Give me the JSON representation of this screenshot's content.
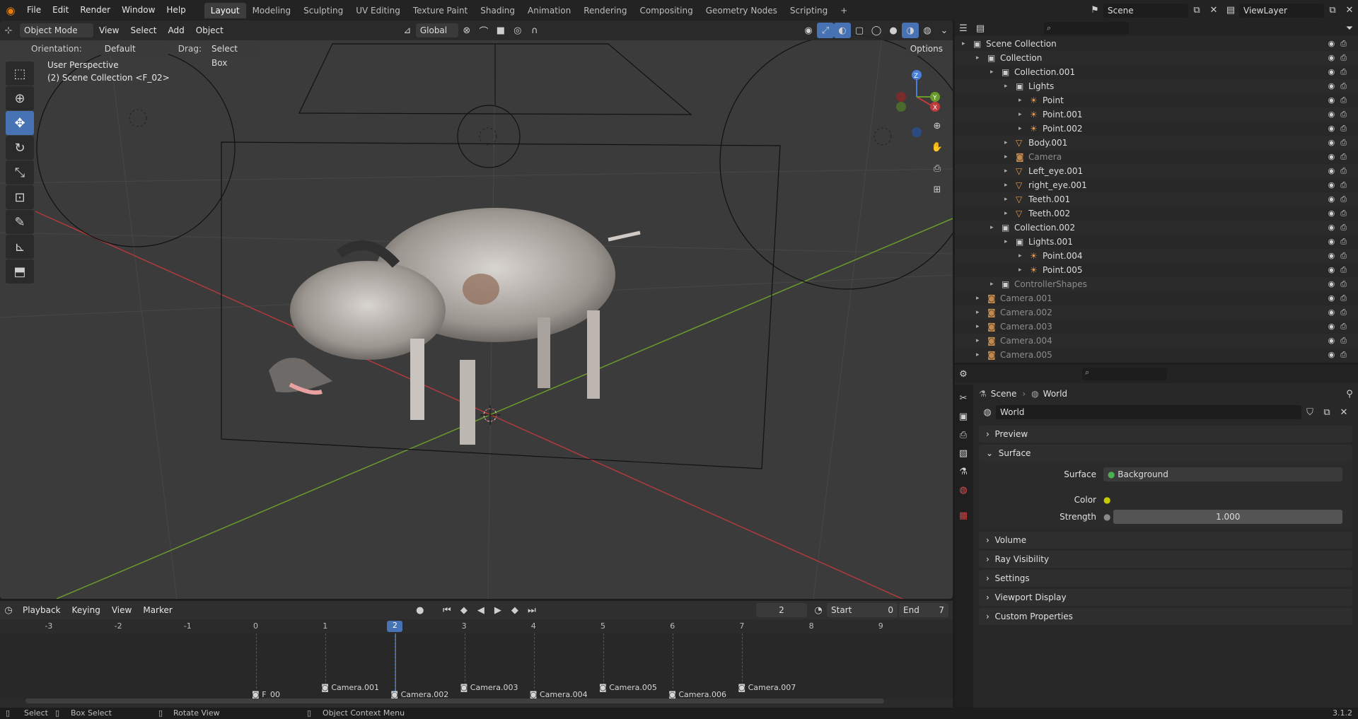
{
  "topbar": {
    "menus": [
      "File",
      "Edit",
      "Render",
      "Window",
      "Help"
    ],
    "workspaces": [
      "Layout",
      "Modeling",
      "Sculpting",
      "UV Editing",
      "Texture Paint",
      "Shading",
      "Animation",
      "Rendering",
      "Compositing",
      "Geometry Nodes",
      "Scripting"
    ],
    "active_workspace": "Layout",
    "add_tab": "+",
    "scene": "Scene",
    "view_layer": "ViewLayer"
  },
  "viewport": {
    "mode": "Object Mode",
    "menus": [
      "View",
      "Select",
      "Add",
      "Object"
    ],
    "transform_orientation": "Global",
    "orientation_label": "Orientation:",
    "orientation_value": "Default",
    "drag_label": "Drag:",
    "drag_value": "Select Box",
    "options": "Options",
    "view_name": "User Perspective",
    "collection_info": "(2) Scene Collection <F_02>",
    "axes": {
      "x": "X",
      "y": "Y",
      "z": "Z"
    }
  },
  "outliner": {
    "rows": [
      {
        "label": "Scene Collection",
        "indent": 0,
        "icon": "scene-collection-icon",
        "dim": false
      },
      {
        "label": "Collection",
        "indent": 1,
        "icon": "collection-icon",
        "dim": false
      },
      {
        "label": "Collection.001",
        "indent": 2,
        "icon": "collection-icon",
        "dim": false
      },
      {
        "label": "Lights",
        "indent": 3,
        "icon": "collection-icon",
        "dim": false
      },
      {
        "label": "Point",
        "indent": 4,
        "icon": "light-icon",
        "dim": false
      },
      {
        "label": "Point.001",
        "indent": 4,
        "icon": "light-icon",
        "dim": false
      },
      {
        "label": "Point.002",
        "indent": 4,
        "icon": "light-icon",
        "dim": false
      },
      {
        "label": "Body.001",
        "indent": 3,
        "icon": "mesh-icon",
        "dim": false
      },
      {
        "label": "Camera",
        "indent": 3,
        "icon": "camera-icon",
        "dim": true
      },
      {
        "label": "Left_eye.001",
        "indent": 3,
        "icon": "mesh-icon",
        "dim": false
      },
      {
        "label": "right_eye.001",
        "indent": 3,
        "icon": "mesh-icon",
        "dim": false
      },
      {
        "label": "Teeth.001",
        "indent": 3,
        "icon": "mesh-icon",
        "dim": false
      },
      {
        "label": "Teeth.002",
        "indent": 3,
        "icon": "mesh-icon",
        "dim": false
      },
      {
        "label": "Collection.002",
        "indent": 2,
        "icon": "collection-icon",
        "dim": false
      },
      {
        "label": "Lights.001",
        "indent": 3,
        "icon": "collection-icon",
        "dim": false
      },
      {
        "label": "Point.004",
        "indent": 4,
        "icon": "light-icon",
        "dim": false
      },
      {
        "label": "Point.005",
        "indent": 4,
        "icon": "light-icon",
        "dim": false
      },
      {
        "label": "ControllerShapes",
        "indent": 2,
        "icon": "collection-icon",
        "dim": true
      },
      {
        "label": "Camera.001",
        "indent": 1,
        "icon": "camera-icon",
        "dim": true
      },
      {
        "label": "Camera.002",
        "indent": 1,
        "icon": "camera-icon",
        "dim": true
      },
      {
        "label": "Camera.003",
        "indent": 1,
        "icon": "camera-icon",
        "dim": true
      },
      {
        "label": "Camera.004",
        "indent": 1,
        "icon": "camera-icon",
        "dim": true
      },
      {
        "label": "Camera.005",
        "indent": 1,
        "icon": "camera-icon",
        "dim": true
      }
    ]
  },
  "properties": {
    "breadcrumb": [
      "Scene",
      "World"
    ],
    "world_name": "World",
    "panels": {
      "preview": "Preview",
      "surface": "Surface",
      "volume": "Volume",
      "ray_visibility": "Ray Visibility",
      "settings": "Settings",
      "viewport_display": "Viewport Display",
      "custom_properties": "Custom Properties"
    },
    "surface_label": "Surface",
    "surface_value": "Background",
    "color_label": "Color",
    "strength_label": "Strength",
    "strength_value": "1.000"
  },
  "timeline": {
    "menus": [
      "Playback",
      "Keying",
      "View",
      "Marker"
    ],
    "current_frame": "2",
    "start_label": "Start",
    "start_value": "0",
    "end_label": "End",
    "end_value": "7",
    "ticks": [
      "-3",
      "-2",
      "-1",
      "0",
      "1",
      "2",
      "3",
      "4",
      "5",
      "6",
      "7",
      "8",
      "9"
    ],
    "markers": [
      "F_00",
      "Camera.001",
      "Camera.002",
      "Camera.003",
      "Camera.004",
      "Camera.005",
      "Camera.006",
      "Camera.007"
    ]
  },
  "statusbar": {
    "select": "Select",
    "box_select": "Box Select",
    "rotate_view": "Rotate View",
    "context_menu": "Object Context Menu",
    "version": "3.1.2"
  },
  "colors": {
    "accent": "#4772b3",
    "orange": "#e87d0d",
    "green_axis": "#6b9a2c",
    "red_axis": "#c0393b"
  }
}
